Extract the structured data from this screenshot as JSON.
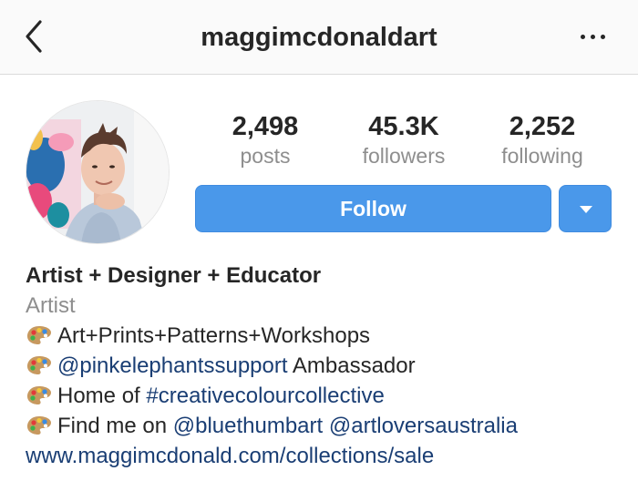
{
  "header": {
    "title": "maggimcdonaldart",
    "back_icon": "chevron-left-icon",
    "more_icon": "more-horizontal-icon"
  },
  "profile": {
    "avatar_icon": "profile-photo"
  },
  "stats": [
    {
      "value": "2,498",
      "label": "posts"
    },
    {
      "value": "45.3K",
      "label": "followers"
    },
    {
      "value": "2,252",
      "label": "following"
    }
  ],
  "actions": {
    "follow_label": "Follow",
    "dropdown_icon": "triangle-down-icon",
    "button_color": "#4a98ea"
  },
  "bio": {
    "name": "Artist + Designer + Educator",
    "category": "Artist",
    "emoji_icon": "artist-palette-icon",
    "line1": "Art+Prints+Patterns+Workshops",
    "line2_link": "@pinkelephantssupport",
    "line2_text": " Ambassador",
    "line3_text": "Home of ",
    "line3_link": "#creativecolourcollective",
    "line4_text": "Find me on ",
    "line4_link1": "@bluethumbart",
    "line4_link2": "@artloversaustralia",
    "website": "www.maggimcdonald.com/collections/sale",
    "link_color": "#1a3e74"
  }
}
